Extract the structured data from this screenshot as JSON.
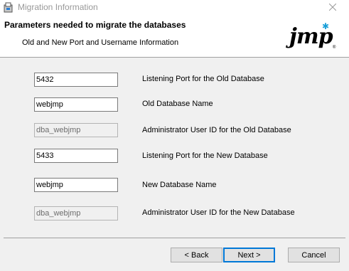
{
  "window": {
    "title": "Migration Information"
  },
  "header": {
    "title": "Parameters needed to migrate the databases",
    "subtitle": "Old and New Port and Username Information",
    "logo_text": "jmp",
    "logo_trademark": "®"
  },
  "fields": [
    {
      "value": "5432",
      "label": "Listening Port for the Old Database",
      "enabled": true
    },
    {
      "value": "webjmp",
      "label": "Old Database Name",
      "enabled": true
    },
    {
      "value": "dba_webjmp",
      "label": "Administrator User ID for the Old Database",
      "enabled": false
    },
    {
      "value": "5433",
      "label": "Listening Port for the New Database",
      "enabled": true
    },
    {
      "value": "webjmp",
      "label": "New Database Name",
      "enabled": true
    },
    {
      "value": "dba_webjmp",
      "label": "Administrator User ID for the New Database",
      "enabled": false
    }
  ],
  "buttons": {
    "back": "< Back",
    "next": "Next >",
    "cancel": "Cancel"
  },
  "colors": {
    "accent": "#0078d7",
    "logo_star": "#1a9fd8",
    "title_text": "#999999"
  }
}
